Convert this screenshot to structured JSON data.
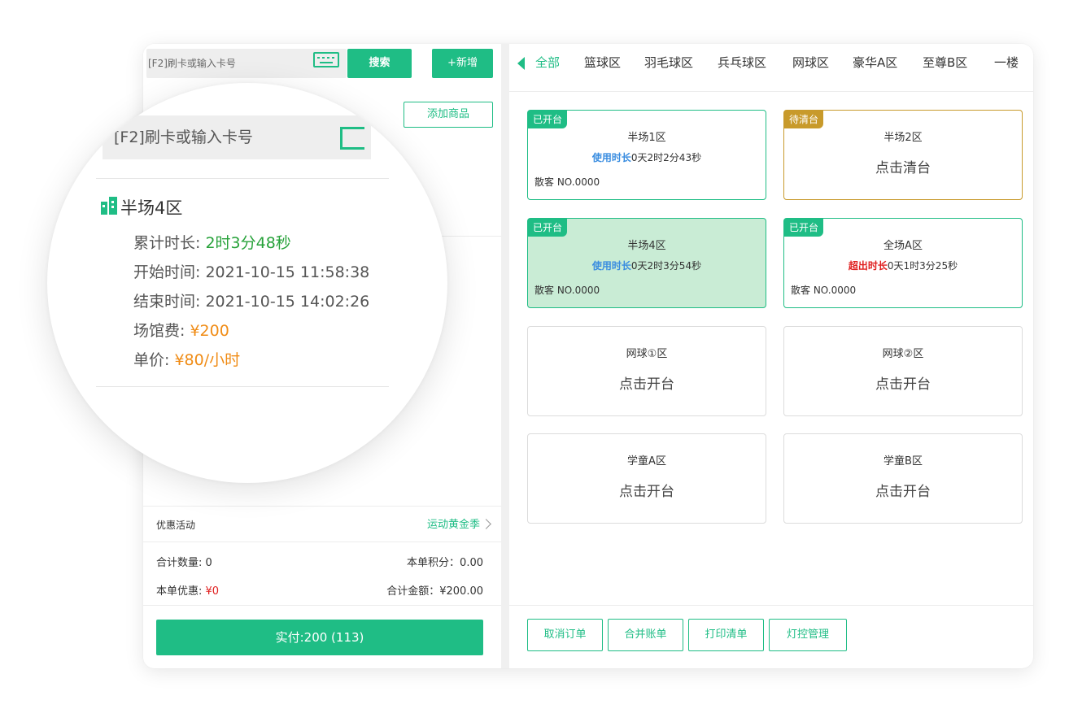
{
  "left": {
    "search_placeholder": "[F2]刷卡或输入卡号",
    "search_button": "搜索",
    "new_button": "+新增",
    "add_goods_button": "添加商品",
    "promo": {
      "label": "优惠活动",
      "value": "运动黄金季"
    },
    "summary": {
      "qty_label": "合计数量: 0",
      "points_label": "本单积分：0.00",
      "discount_label": "本单优惠: ",
      "discount_value": "¥0",
      "total_label": "合计金额：¥200.00"
    },
    "pay_button": "实付:200 (113)"
  },
  "magnifier": {
    "search_placeholder": "[F2]刷卡或输入卡号",
    "venue": "半场4区",
    "rows": [
      {
        "label": "累计时长: ",
        "value": "2时3分48秒",
        "color": "#27a23a"
      },
      {
        "label": "开始时间: ",
        "value": "2021-10-15 11:58:38",
        "color": "#555555"
      },
      {
        "label": "结束时间: ",
        "value": "2021-10-15 14:02:26",
        "color": "#555555"
      },
      {
        "label": "场馆费: ",
        "value": "¥200",
        "color": "#f08c16"
      },
      {
        "label": "单价: ",
        "value": "¥80/小时",
        "color": "#f08c16"
      }
    ]
  },
  "tabs": [
    "全部",
    "篮球区",
    "羽毛球区",
    "兵乓球区",
    "网球区",
    "豪华A区",
    "至尊B区",
    "一楼"
  ],
  "cards": [
    {
      "badge": "已开台",
      "name": "半场1区",
      "dur_label": "使用时长",
      "dur_value": "0天2时2分43秒",
      "guest": "散客 NO.0000"
    },
    {
      "badge": "待清台",
      "name": "半场2区",
      "action": "点击清台"
    },
    {
      "badge": "已开台",
      "name": "半场4区",
      "dur_label": "使用时长",
      "dur_value": "0天2时3分54秒",
      "guest": "散客 NO.0000"
    },
    {
      "badge": "已开台",
      "name": "全场A区",
      "dur_label": "超出时长",
      "dur_value": "0天1时3分25秒",
      "guest": "散客 NO.0000"
    },
    {
      "name": "网球①区",
      "action": "点击开台"
    },
    {
      "name": "网球②区",
      "action": "点击开台"
    },
    {
      "name": "学童A区",
      "action": "点击开台"
    },
    {
      "name": "学童B区",
      "action": "点击开台"
    }
  ],
  "actions": [
    "取消订单",
    "合并账单",
    "打印清单",
    "灯控管理"
  ],
  "colors": {
    "accent": "#1fbd85",
    "warning": "#c89a2b",
    "over": "#e02020",
    "duration": "#3a8de0"
  }
}
